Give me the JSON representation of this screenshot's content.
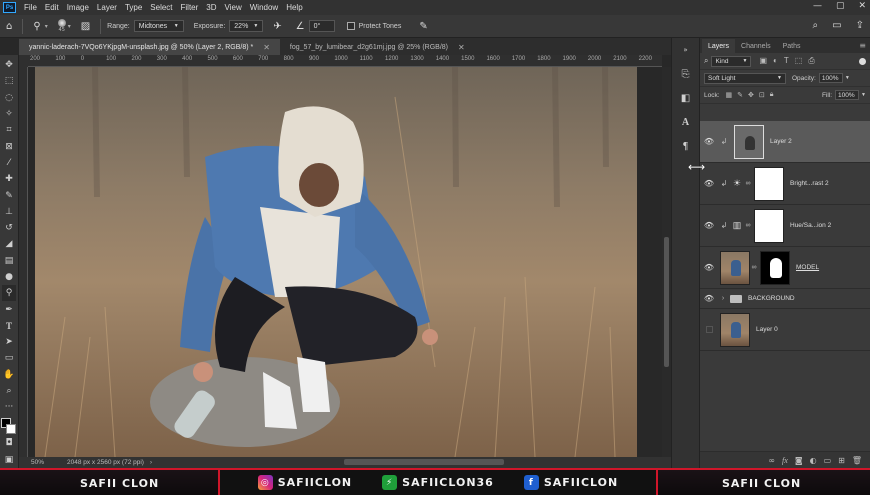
{
  "menu": {
    "logo": "Ps",
    "items": [
      "File",
      "Edit",
      "Image",
      "Layer",
      "Type",
      "Select",
      "Filter",
      "3D",
      "View",
      "Window",
      "Help"
    ],
    "window_controls": [
      "—",
      "▢",
      "✕"
    ]
  },
  "options": {
    "brush_size": "45",
    "range_label": "Range:",
    "range_value": "Midtones",
    "exposure_label": "Exposure:",
    "exposure_value": "22%",
    "angle_value": "0°",
    "protect_tones_label": "Protect Tones"
  },
  "tabs": [
    {
      "label": "yannic-laderach-7VQo6YKjpgM-unsplash.jpg @ 50% (Layer 2, RGB/8) *",
      "active": true
    },
    {
      "label": "fog_57_by_lumibear_d2g61mj.jpg @ 25% (RGB/8)",
      "active": false
    }
  ],
  "ruler_ticks": [
    "200",
    "100",
    "0",
    "100",
    "200",
    "300",
    "400",
    "500",
    "600",
    "700",
    "800",
    "900",
    "1000",
    "1100",
    "1200",
    "1300",
    "1400",
    "1500",
    "1600",
    "1700",
    "1800",
    "1900",
    "2000",
    "2100",
    "2200"
  ],
  "status": {
    "zoom": "50%",
    "doc_info": "2048 px x 2560 px (72 ppi)"
  },
  "layers_panel": {
    "tabs": [
      "Layers",
      "Channels",
      "Paths"
    ],
    "filter_kind": "Kind",
    "blend_mode": "Soft Light",
    "opacity_label": "Opacity:",
    "opacity_value": "100%",
    "lock_label": "Lock:",
    "fill_label": "Fill:",
    "fill_value": "100%",
    "layers": [
      {
        "name": "Layer 2",
        "type": "selected"
      },
      {
        "name": "Bright...rast 2",
        "type": "brightness"
      },
      {
        "name": "Hue/Sa...ion 2",
        "type": "hue"
      },
      {
        "name": "MODEL",
        "type": "model"
      },
      {
        "name": "BACKGROUND",
        "type": "group"
      },
      {
        "name": "Layer 0",
        "type": "base"
      }
    ]
  },
  "banner": {
    "left": "SAFII CLON",
    "instagram": "SAFIICLON",
    "zebra": "SAFIICLON36",
    "facebook": "SAFIICLON",
    "right": "SAFII CLON"
  },
  "colors": {
    "accent": "#31a8ff",
    "banner_red": "#d0162a",
    "foreground_swatch": "#000000",
    "background_swatch": "#ffffff"
  }
}
